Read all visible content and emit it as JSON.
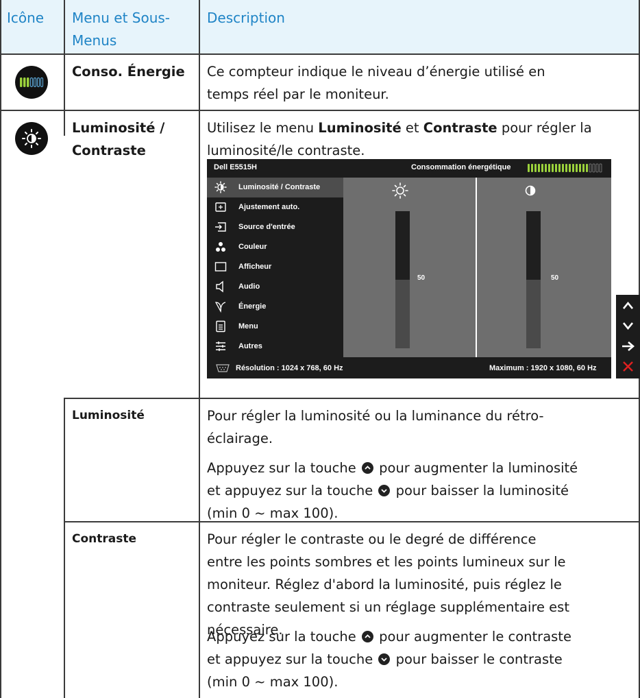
{
  "header": {
    "col_icon": "Icône",
    "col_menu": "Menu et Sous-Menus",
    "col_menu_line1": "Menu et Sous-",
    "col_menu_line2": "Menus",
    "col_desc": "Description"
  },
  "rows": {
    "energy": {
      "icon": "energy-meter-icon",
      "label": "Conso. Énergie",
      "desc_line1": "Ce compteur indique le niveau d’énergie utilisé en",
      "desc_line2": "temps réel par le moniteur."
    },
    "brightness_contrast": {
      "icon": "brightness-contrast-icon",
      "label_line1": "Luminosité /",
      "label_line2": "Contraste",
      "desc_pre": "Utilisez le menu ",
      "desc_bold1": "Luminosité",
      "desc_mid": " et ",
      "desc_bold2": "Contraste",
      "desc_post": " pour régler la",
      "desc_line2": "luminosité/le contraste."
    },
    "brightness": {
      "label": "Luminosité",
      "p1_line1": "Pour régler la luminosité ou la luminance du rétro-",
      "p1_line2": "éclairage.",
      "p2_a": "Appuyez sur la touche ",
      "p2_b": " pour augmenter la luminosité",
      "p2_c": "et appuyez sur la touche ",
      "p2_d": " pour baisser la luminosité",
      "p2_e": "(min 0 ~ max 100)."
    },
    "contrast": {
      "label": "Contraste",
      "p1_line1": "Pour régler le contraste ou le degré de différence",
      "p1_line2": "entre les points sombres et les points lumineux sur le",
      "p1_line3": "moniteur.  Réglez d'abord la luminosité, puis réglez le",
      "p1_line4": "contraste seulement si un réglage supplémentaire est",
      "p1_line5": "nécessaire.",
      "p2_a": "Appuyez sur la touche ",
      "p2_b": " pour augmenter le contraste",
      "p2_c": "et appuyez sur la touche ",
      "p2_d": " pour baisser le contraste",
      "p2_e": "(min 0 ~ max 100)."
    }
  },
  "osd": {
    "model": "Dell E5515H",
    "consumption_label": "Consommation énergétique",
    "energy_level": 0.8,
    "menu_items": [
      {
        "label": "Luminosité / Contraste",
        "icon": "brightness-icon",
        "selected": true
      },
      {
        "label": "Ajustement auto.",
        "icon": "auto-adjust-icon",
        "selected": false
      },
      {
        "label": "Source d'entrée",
        "icon": "input-source-icon",
        "selected": false
      },
      {
        "label": "Couleur",
        "icon": "color-icon",
        "selected": false
      },
      {
        "label": "Afficheur",
        "icon": "display-icon",
        "selected": false
      },
      {
        "label": "Audio",
        "icon": "audio-icon",
        "selected": false
      },
      {
        "label": "Énergie",
        "icon": "energy-leaf-icon",
        "selected": false
      },
      {
        "label": "Menu",
        "icon": "menu-icon",
        "selected": false
      },
      {
        "label": "Autres",
        "icon": "others-icon",
        "selected": false
      }
    ],
    "brightness_value": "50",
    "brightness_level": 0.5,
    "contrast_value": "50",
    "contrast_level": 0.5,
    "resolution": "Résolution : 1024 x 768, 60 Hz",
    "maximum": "Maximum : 1920 x 1080, 60 Hz",
    "nav_buttons": [
      "up-arrow-icon",
      "down-arrow-icon",
      "right-arrow-icon",
      "close-icon"
    ],
    "colors": {
      "accent_green": "#9bd23c",
      "close_red": "#e02020",
      "header_blue": "#1f84c6",
      "header_bg": "#e7f4fb"
    }
  }
}
